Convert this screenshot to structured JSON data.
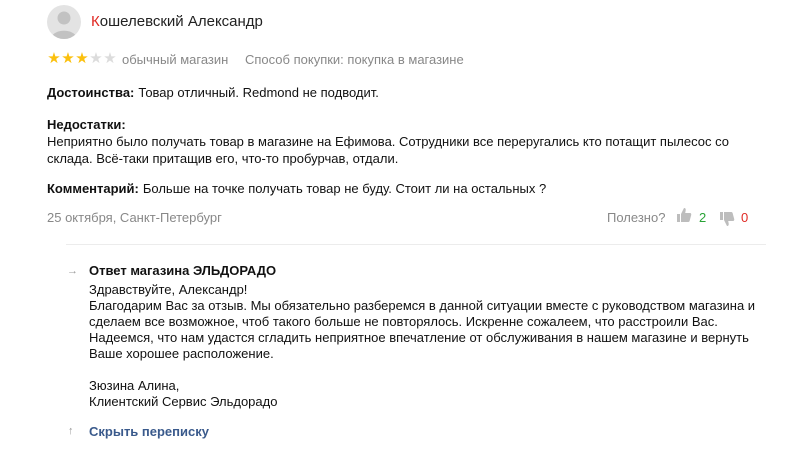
{
  "review": {
    "author_first_letter": "К",
    "author_rest": "ошелевский Александр",
    "rating": 3,
    "rating_max": 5,
    "rating_label": "обычный магазин",
    "purchase_method": "Способ покупки: покупка в магазине",
    "pros_label": "Достоинства:",
    "pros_text": "Товар отличный. Redmond не подводит.",
    "cons_label": "Недостатки:",
    "cons_lines": [
      "Неприятно было получать товар в магазине на Ефимова. Сотрудники все переругались кто потащит пылесос со",
      "склада. Всё-таки притащив его, что-то пробурчав, отдали."
    ],
    "comment_label": "Комментарий:",
    "comment_text": "Больше на точке получать товар не буду. Стоит ли на остальных ?",
    "date_location": "25 октября, Санкт-Петербург",
    "useful_label": "Полезно?",
    "likes": "2",
    "dislikes": "0"
  },
  "reply": {
    "title": "Ответ магазина ЭЛЬДОРАДО",
    "lines": [
      "Здравствуйте, Александр!",
      "Благодарим Вас за отзыв. Мы обязательно разберемся в данной ситуации вместе с руководством магазина и",
      "сделаем все возможное, чтоб такого больше не повторялось. Искренне сожалеем, что расстроили Вас.",
      "Надеемся, что нам удастся сгладить неприятное впечатление от обслуживания в нашем магазине и вернуть",
      "Ваше хорошее расположение.",
      "",
      "Зюзина Алина,",
      "Клиентский Сервис Эльдорадо"
    ],
    "collapse_label": "Скрыть переписку"
  },
  "icons": {
    "arrow_right": "→",
    "arrow_up": "↑",
    "star": "★"
  },
  "colors": {
    "star_on": "#fbc00d",
    "star_off": "#dcdcdc",
    "like": "#28a336",
    "dislike": "#e02a24",
    "link": "#3a5a8c"
  }
}
